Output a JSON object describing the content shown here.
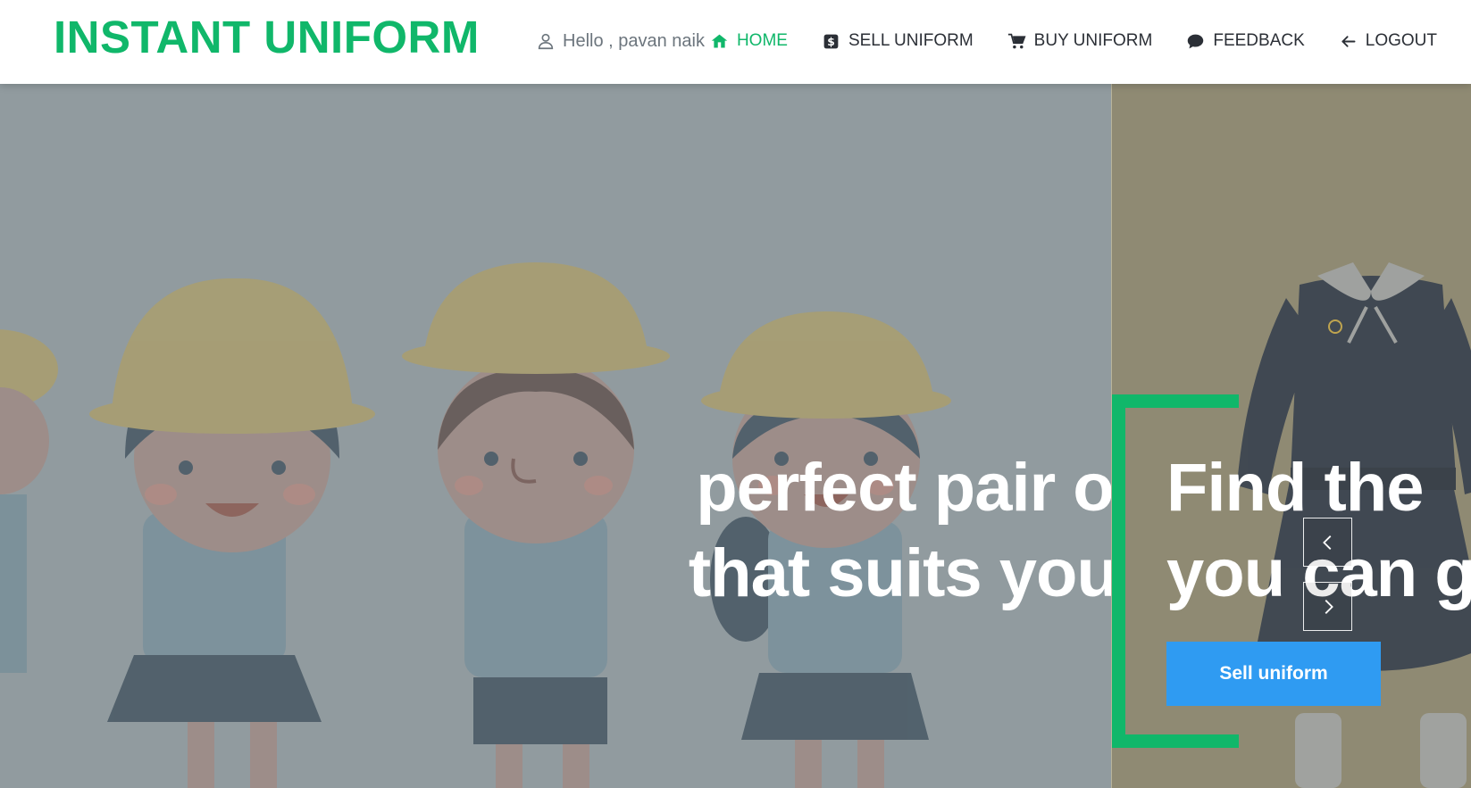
{
  "brand": {
    "name": "INSTANT UNIFORM",
    "color": "#10b76a"
  },
  "user": {
    "greeting": "Hello , pavan naik",
    "icon": "user-icon"
  },
  "nav": {
    "items": [
      {
        "label": "HOME",
        "icon": "home-icon",
        "active": true
      },
      {
        "label": "SELL UNIFORM",
        "icon": "dollar-icon",
        "active": false
      },
      {
        "label": "BUY UNIFORM",
        "icon": "cart-icon",
        "active": false
      },
      {
        "label": "FEEDBACK",
        "icon": "chat-icon",
        "active": false
      },
      {
        "label": "LOGOUT",
        "icon": "arrow-left-icon",
        "active": false
      }
    ]
  },
  "hero": {
    "slides": [
      {
        "heading_lines": [
          "perfect pair of",
          "that suits you."
        ],
        "background": "#919b9f"
      },
      {
        "heading_lines": [
          "Find the",
          "you can g"
        ],
        "button_label": "Sell uniform",
        "background": "#8f8a73"
      }
    ],
    "prev_icon": "chevron-left-icon",
    "next_icon": "chevron-right-icon",
    "accent": "#10b76a",
    "button_color": "#2f9bf2"
  }
}
